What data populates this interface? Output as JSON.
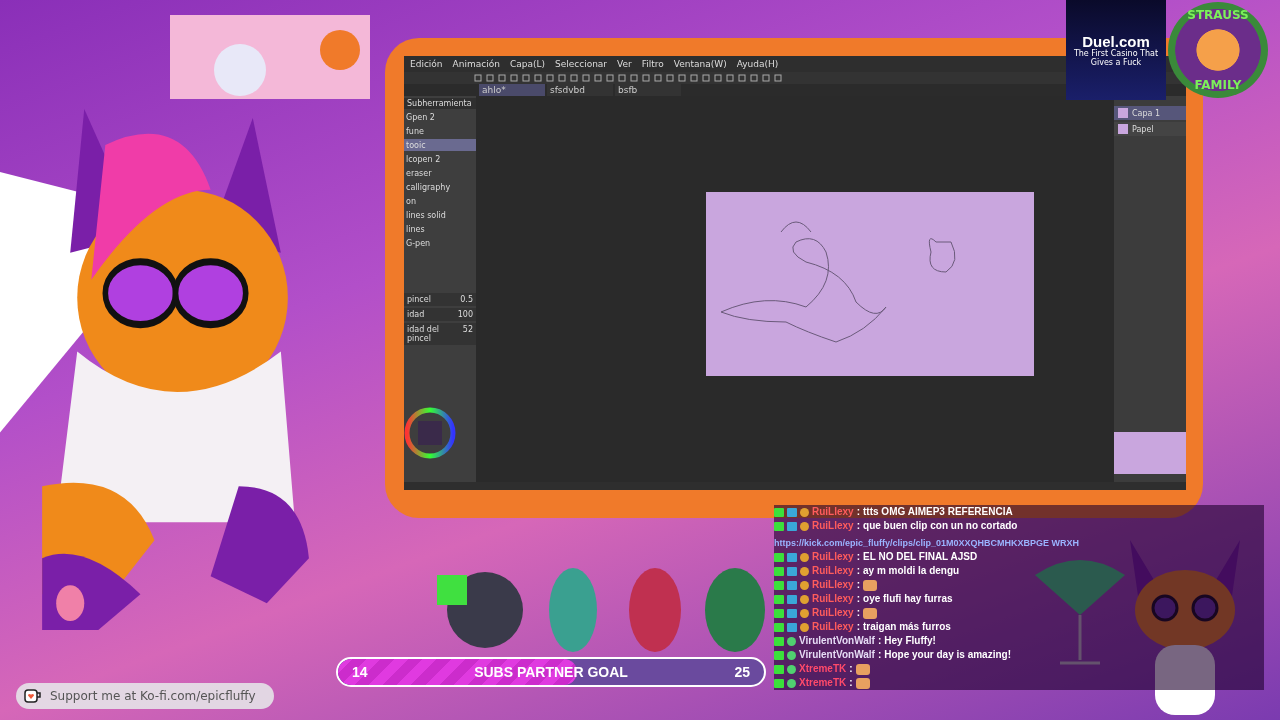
{
  "app_window": {
    "menu": [
      "Edición",
      "Animación",
      "Capa(L)",
      "Seleccionar",
      "Ver",
      "Filtro",
      "Ventana(W)",
      "Ayuda(H)"
    ],
    "tabs": [
      {
        "label": "ahlo*",
        "selected": true
      },
      {
        "label": "sfsdvbd",
        "selected": false
      },
      {
        "label": "bsfb",
        "selected": false
      }
    ],
    "subtool_title": "Subherramienta",
    "brushes": [
      {
        "name": "Gpen 2",
        "selected": false
      },
      {
        "name": "fune",
        "selected": false
      },
      {
        "name": "tooic",
        "selected": true
      },
      {
        "name": "lcopen 2",
        "selected": false
      },
      {
        "name": "eraser",
        "selected": false
      },
      {
        "name": "calligraphy",
        "selected": false
      },
      {
        "name": "on",
        "selected": false
      },
      {
        "name": "lines solid",
        "selected": false
      },
      {
        "name": "lines",
        "selected": false
      },
      {
        "name": "G-pen",
        "selected": false
      }
    ],
    "properties": [
      {
        "label": "pincel",
        "value": "0.5"
      },
      {
        "label": "idad",
        "value": "100"
      },
      {
        "label": "idad del pincel",
        "value": "52"
      }
    ],
    "layers": [
      {
        "name": "Capa 1",
        "selected": true
      },
      {
        "name": "Papel",
        "selected": false
      }
    ]
  },
  "sponsor": {
    "name": "Duel.com",
    "tagline": "The First Casino That Gives a Fuck"
  },
  "badge": {
    "top": "STRAUSS",
    "bottom": "FAMILY"
  },
  "chat": [
    {
      "user": "RuiLlexy",
      "color": "#ff5c5c",
      "subscriber": true,
      "separator": ":",
      "kind": "text",
      "text": "ttts OMG AIMEP3 REFERENCIA"
    },
    {
      "user": "RuiLlexy",
      "color": "#ff5c5c",
      "subscriber": true,
      "separator": ":",
      "kind": "text",
      "text": "que buen clip con un no cortado",
      "link": "https://kick.com/epic_fluffy/clips/clip_01M0XXQHBCMHKXBPGE WRXH"
    },
    {
      "user": "RuiLlexy",
      "color": "#ff5c5c",
      "subscriber": true,
      "separator": ":",
      "kind": "text",
      "text": "EL NO DEL FINAL AJSD"
    },
    {
      "user": "RuiLlexy",
      "color": "#ff5c5c",
      "subscriber": true,
      "separator": ":",
      "kind": "text",
      "text": "ay m moldi la dengu"
    },
    {
      "user": "RuiLlexy",
      "color": "#ff5c5c",
      "subscriber": true,
      "separator": ":",
      "kind": "emote"
    },
    {
      "user": "RuiLlexy",
      "color": "#ff5c5c",
      "subscriber": true,
      "separator": ":",
      "kind": "text",
      "text": "oye flufi hay furras"
    },
    {
      "user": "RuiLlexy",
      "color": "#ff5c5c",
      "subscriber": true,
      "separator": ":",
      "kind": "emote"
    },
    {
      "user": "RuiLlexy",
      "color": "#ff5c5c",
      "subscriber": true,
      "separator": ":",
      "kind": "text",
      "text": "traigan más furros"
    },
    {
      "user": "VirulentVonWalf",
      "color": "#e6dcf5",
      "subscriber": false,
      "separator": ":",
      "kind": "text",
      "text": "Hey Fluffy!"
    },
    {
      "user": "VirulentVonWalf",
      "color": "#e6dcf5",
      "subscriber": false,
      "separator": ":",
      "kind": "text",
      "text": "Hope your day is amazing!"
    },
    {
      "user": "XtremeTK",
      "color": "#ff4a6a",
      "subscriber": false,
      "separator": ":",
      "kind": "emote"
    },
    {
      "user": "XtremeTK",
      "color": "#ff4a6a",
      "subscriber": false,
      "separator": ":",
      "kind": "emote"
    }
  ],
  "goal": {
    "current": "14",
    "title": "SUBS PARTNER GOAL",
    "target": "25",
    "level": 0.56
  },
  "kofi": {
    "text": "Support me at Ko-fi.com/epicfluffy"
  }
}
